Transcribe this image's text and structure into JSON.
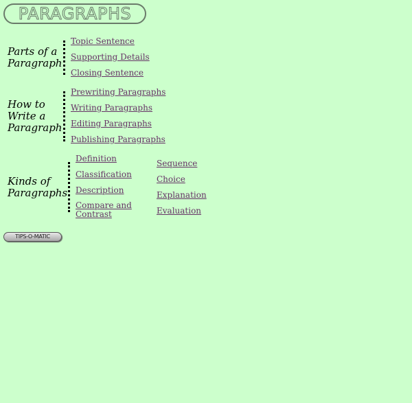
{
  "logo": {
    "text": "PARAGRAPHS"
  },
  "sections": {
    "parts": {
      "heading": [
        "Parts of a",
        "Paragraph"
      ],
      "links": [
        "Topic Sentence",
        "Supporting Details",
        "Closing Sentence"
      ]
    },
    "how": {
      "heading": [
        "How to",
        "Write a",
        "Paragraph"
      ],
      "links": [
        "Prewriting Paragraphs",
        "Writing Paragraphs",
        "Editing Paragraphs",
        "Publishing Paragraphs"
      ]
    },
    "kinds": {
      "heading": [
        "Kinds of",
        "Paragraphs"
      ],
      "links_col1": [
        "Definition",
        "Classification",
        "Description",
        "Compare and Contrast"
      ],
      "links_col2": [
        "Sequence",
        "Choice",
        "Explanation",
        "Evaluation"
      ]
    }
  },
  "tips_button": {
    "label": "TIPS-O-MATIC"
  }
}
